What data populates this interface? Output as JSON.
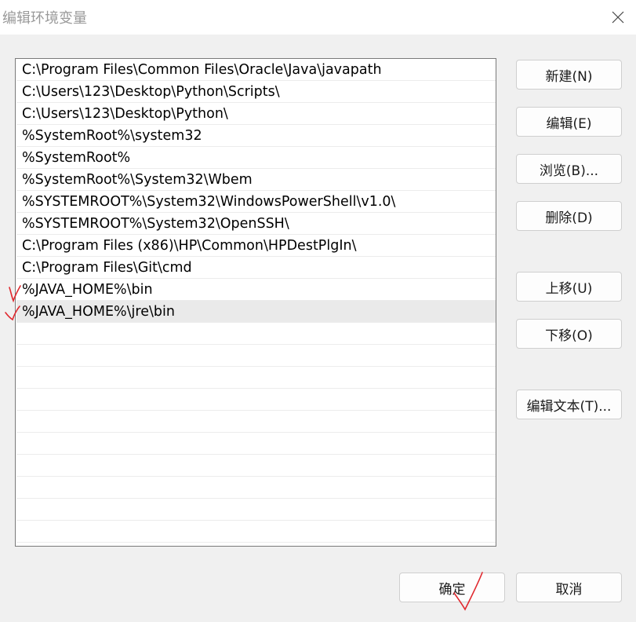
{
  "window": {
    "title": "编辑环境变量",
    "close_icon": "close-icon"
  },
  "path_list": {
    "items": [
      "C:\\Program Files\\Common Files\\Oracle\\Java\\javapath",
      "C:\\Users\\123\\Desktop\\Python\\Scripts\\",
      "C:\\Users\\123\\Desktop\\Python\\",
      "%SystemRoot%\\system32",
      "%SystemRoot%",
      "%SystemRoot%\\System32\\Wbem",
      "%SYSTEMROOT%\\System32\\WindowsPowerShell\\v1.0\\",
      "%SYSTEMROOT%\\System32\\OpenSSH\\",
      "C:\\Program Files (x86)\\HP\\Common\\HPDestPlgIn\\",
      "C:\\Program Files\\Git\\cmd",
      "%JAVA_HOME%\\bin",
      "%JAVA_HOME%\\jre\\bin"
    ],
    "selected_index": 11
  },
  "side_buttons": {
    "new": "新建(N)",
    "edit": "编辑(E)",
    "browse": "浏览(B)...",
    "delete": "删除(D)",
    "move_up": "上移(U)",
    "move_down": "下移(O)",
    "edit_text": "编辑文本(T)..."
  },
  "footer_buttons": {
    "ok": "确定",
    "cancel": "取消"
  },
  "colors": {
    "annotation_ink": "#e0282e",
    "selected_row": "#eaeaea"
  }
}
